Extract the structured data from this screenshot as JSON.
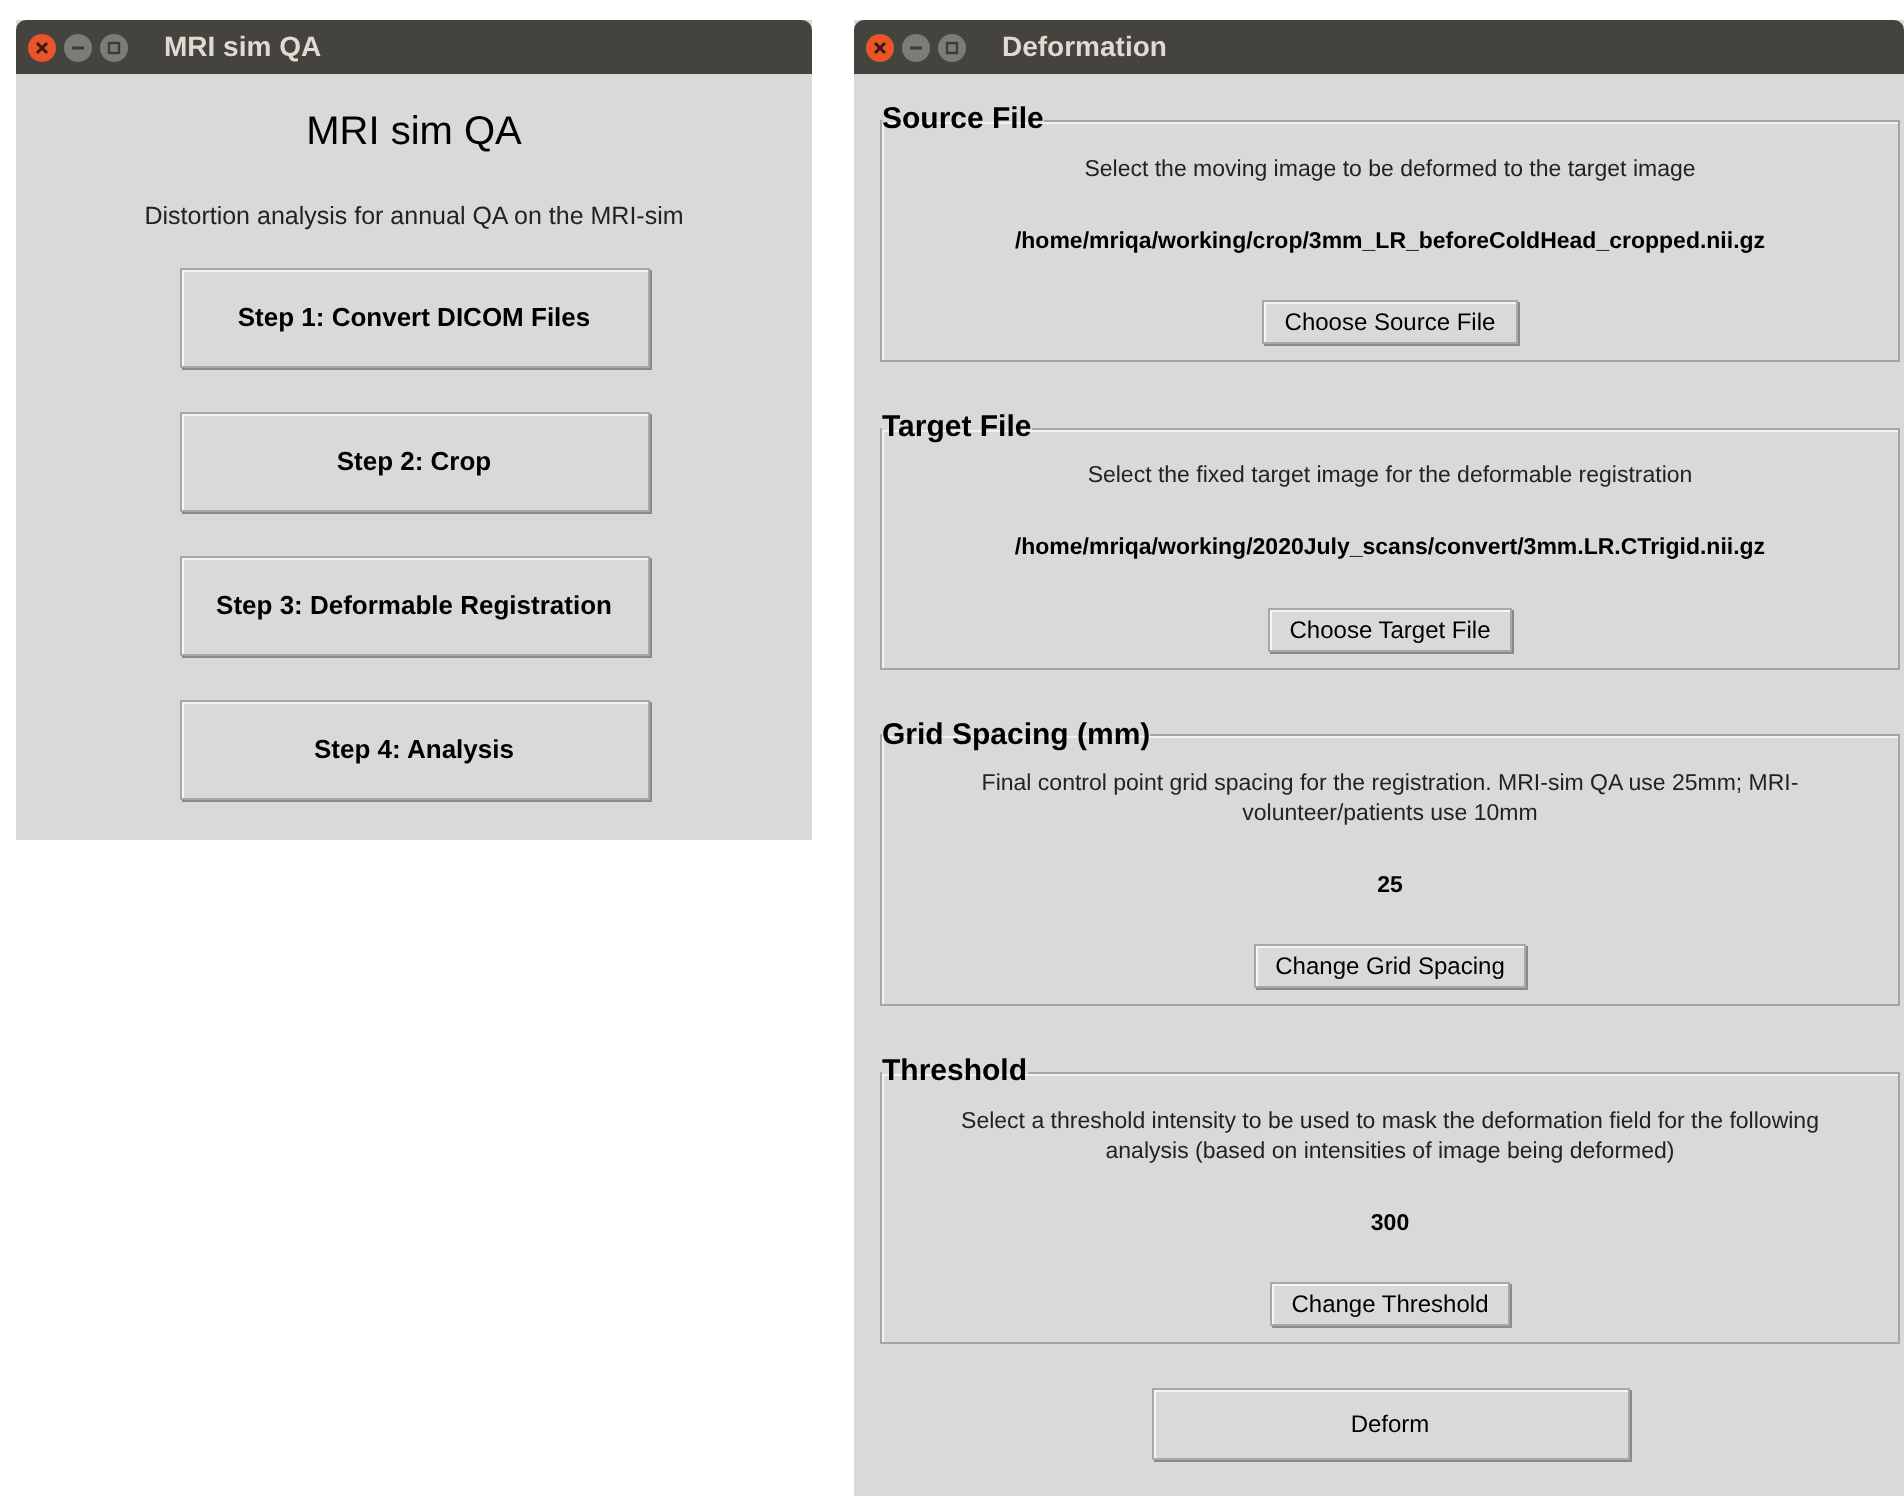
{
  "windows": [
    {
      "title": "MRI sim QA",
      "heading": "MRI sim QA",
      "subtitle": "Distortion analysis for annual QA on the MRI-sim",
      "buttons": [
        "Step 1: Convert DICOM Files",
        "Step 2: Crop",
        "Step 3: Deformable Registration",
        "Step 4: Analysis"
      ]
    },
    {
      "title": "Deformation",
      "sections": [
        {
          "title": "Source File",
          "description": "Select the moving image to be deformed to the target image",
          "value": "/home/mriqa/working/crop/3mm_LR_beforeColdHead_cropped.nii.gz",
          "button": "Choose Source File"
        },
        {
          "title": "Target File",
          "description": "Select the fixed target image for the deformable registration",
          "value": "/home/mriqa/working/2020July_scans/convert/3mm.LR.CTrigid.nii.gz",
          "button": "Choose Target File"
        },
        {
          "title": "Grid Spacing (mm)",
          "description": "Final control point grid spacing for the registration. MRI-sim QA use 25mm; MRI-volunteer/patients use 10mm",
          "value": "25",
          "button": "Change Grid Spacing"
        },
        {
          "title": "Threshold",
          "description": "Select a threshold intensity to be used to mask the deformation field for the following analysis (based on intensities of image being deformed)",
          "value": "300",
          "button": "Change Threshold"
        }
      ],
      "action": "Deform"
    }
  ]
}
